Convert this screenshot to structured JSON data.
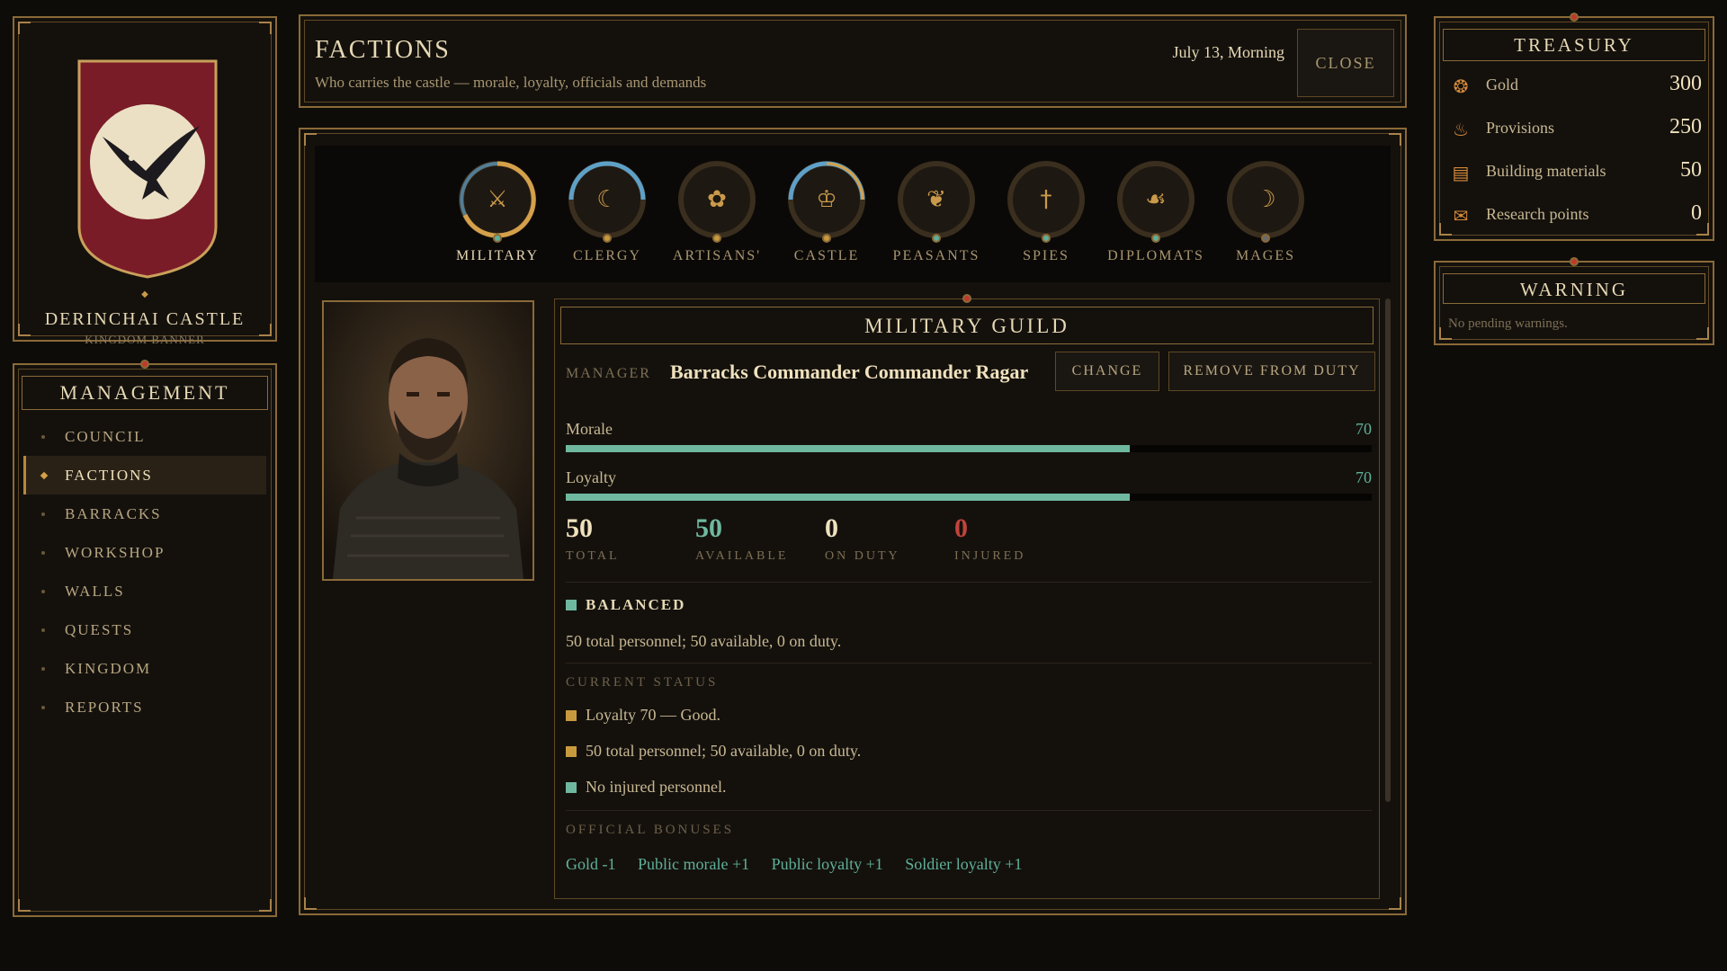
{
  "banner": {
    "castle_name": "DERINCHAI CASTLE",
    "subtitle": "KINGDOM BANNER",
    "colors": {
      "field": "#7a1c28",
      "disc": "#ece0c4"
    }
  },
  "management": {
    "title": "MANAGEMENT",
    "items": [
      {
        "label": "COUNCIL",
        "active": false
      },
      {
        "label": "FACTIONS",
        "active": true
      },
      {
        "label": "BARRACKS",
        "active": false
      },
      {
        "label": "WORKSHOP",
        "active": false
      },
      {
        "label": "WALLS",
        "active": false
      },
      {
        "label": "QUESTS",
        "active": false
      },
      {
        "label": "KINGDOM",
        "active": false
      },
      {
        "label": "REPORTS",
        "active": false
      }
    ]
  },
  "header": {
    "title": "FACTIONS",
    "subtitle": "Who carries the castle — morale, loyalty, officials and demands",
    "date": "July 13, Morning",
    "close_label": "CLOSE"
  },
  "factions": [
    {
      "label": "MILITARY",
      "icon": "sword-icon",
      "active": true,
      "ring": "orange-blue"
    },
    {
      "label": "CLERGY",
      "icon": "moon-icon",
      "active": false,
      "ring": "blue"
    },
    {
      "label": "ARTISANS'",
      "icon": "flower-icon",
      "active": false,
      "ring": "none"
    },
    {
      "label": "CASTLE",
      "icon": "crown-icon",
      "active": false,
      "ring": "blue"
    },
    {
      "label": "PEASANTS",
      "icon": "wheat-icon",
      "active": false,
      "ring": "none"
    },
    {
      "label": "SPIES",
      "icon": "dagger-icon",
      "active": false,
      "ring": "none"
    },
    {
      "label": "DIPLOMATS",
      "icon": "hand-icon",
      "active": false,
      "ring": "none"
    },
    {
      "label": "MAGES",
      "icon": "crescent-icon",
      "active": false,
      "ring": "none"
    }
  ],
  "guild": {
    "title": "MILITARY GUILD",
    "manager_label": "MANAGER",
    "manager_name": "Barracks Commander Commander Ragar",
    "change_label": "CHANGE",
    "remove_label": "REMOVE FROM DUTY",
    "morale": {
      "label": "Morale",
      "value": "70",
      "fraction": 0.7
    },
    "loyalty": {
      "label": "Loyalty",
      "value": "70",
      "fraction": 0.7
    },
    "stats": [
      {
        "value": "50",
        "label": "TOTAL",
        "color": "#f0e2bd"
      },
      {
        "value": "50",
        "label": "AVAILABLE",
        "color": "#6fb8a0"
      },
      {
        "value": "0",
        "label": "ON DUTY",
        "color": "#f0e2bd"
      },
      {
        "value": "0",
        "label": "INJURED",
        "color": "#c0443a"
      }
    ],
    "state_label": "BALANCED",
    "state_text": "50 total personnel; 50 available, 0 on duty.",
    "current_status_label": "CURRENT STATUS",
    "status_lines": [
      {
        "text": "Loyalty 70 — Good.",
        "color": "#c89a3e"
      },
      {
        "text": "50 total personnel; 50 available, 0 on duty.",
        "color": "#c89a3e"
      },
      {
        "text": "No injured personnel.",
        "color": "#6fb8a0"
      }
    ],
    "bonuses_label": "OFFICIAL BONUSES",
    "bonuses": [
      "Gold -1",
      "Public morale +1",
      "Public loyalty +1",
      "Soldier loyalty +1"
    ]
  },
  "treasury": {
    "title": "TREASURY",
    "rows": [
      {
        "name": "Gold",
        "value": "300",
        "icon": "coins-icon"
      },
      {
        "name": "Provisions",
        "value": "250",
        "icon": "food-icon"
      },
      {
        "name": "Building materials",
        "value": "50",
        "icon": "lumber-icon"
      },
      {
        "name": "Research points",
        "value": "0",
        "icon": "scroll-icon"
      }
    ]
  },
  "warning": {
    "title": "WARNING",
    "text": "No pending warnings."
  }
}
